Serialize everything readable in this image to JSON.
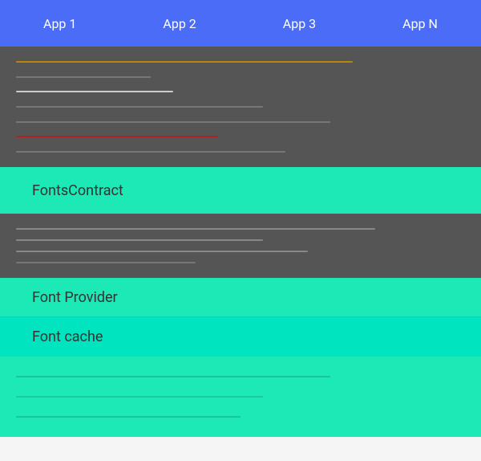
{
  "appBar": {
    "tabs": [
      {
        "label": "App 1"
      },
      {
        "label": "App 2"
      },
      {
        "label": "App 3"
      },
      {
        "label": "App N"
      }
    ]
  },
  "blocks": {
    "fontsContract": {
      "label": "FontsContract"
    },
    "fontProvider": {
      "label": "Font Provider"
    },
    "fontCache": {
      "label": "Font cache"
    }
  },
  "colors": {
    "appBar": "#4a6cf7",
    "darkSection": "#555555",
    "teal": "#1de9b6",
    "tealDark": "#00e5c0"
  }
}
